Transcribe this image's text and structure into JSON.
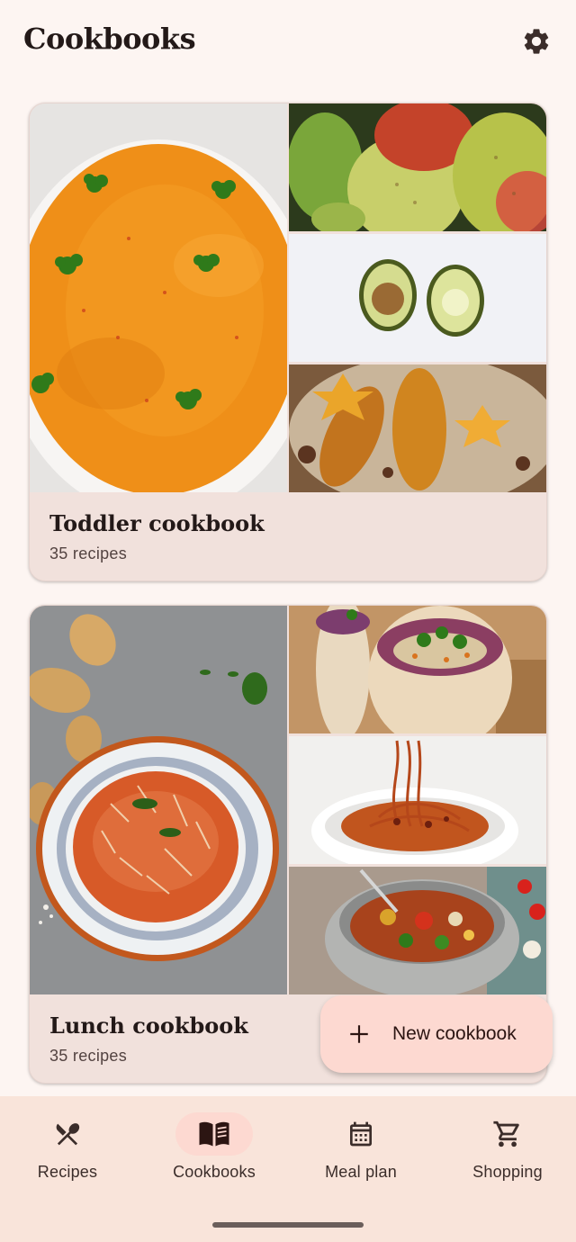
{
  "header": {
    "title": "Cookbooks",
    "settings_icon": "gear-icon"
  },
  "cookbooks": [
    {
      "name": "Toddler cookbook",
      "count": "35 recipes",
      "images": [
        "carrot-soup-bowl",
        "pears",
        "halved-avocado",
        "roasted-pears-oatmeal"
      ]
    },
    {
      "name": "Lunch cookbook",
      "count": "35 recipes",
      "images": [
        "tomato-soup-bowl",
        "veggie-wraps",
        "spaghetti-bolognese",
        "minestrone-soup"
      ]
    }
  ],
  "fab": {
    "label": "New cookbook",
    "icon": "plus-icon"
  },
  "nav": {
    "active": "Cookbooks",
    "items": [
      {
        "label": "Recipes",
        "icon": "utensils-icon"
      },
      {
        "label": "Cookbooks",
        "icon": "book-icon"
      },
      {
        "label": "Meal plan",
        "icon": "calendar-icon"
      },
      {
        "label": "Shopping",
        "icon": "cart-icon"
      }
    ]
  },
  "colors": {
    "background": "#fdf5f2",
    "card": "#f1e1dc",
    "accent": "#fdd9d1",
    "navbar": "#f9e4da"
  }
}
